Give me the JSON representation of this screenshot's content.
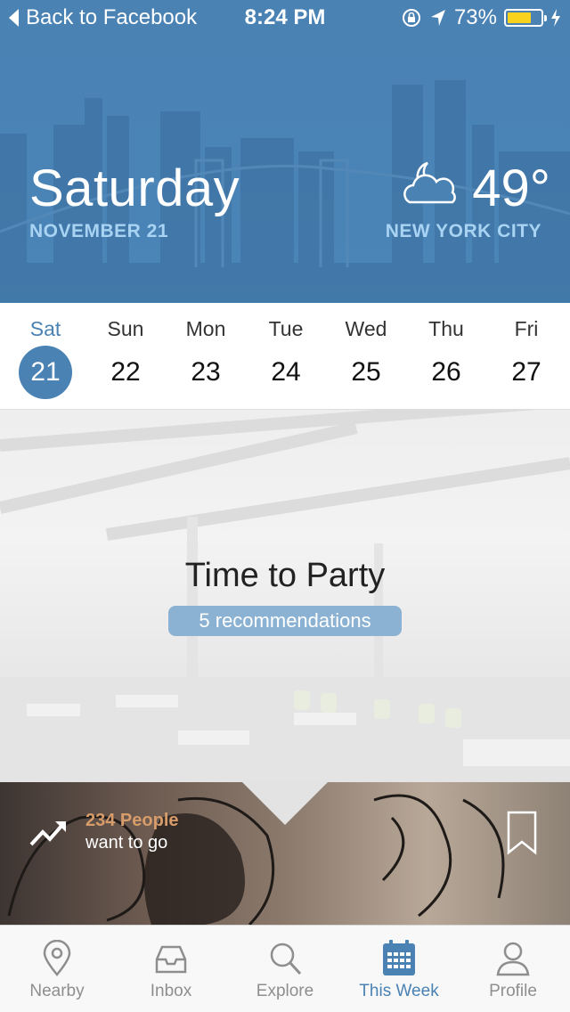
{
  "status_bar": {
    "back_label": "Back to Facebook",
    "time": "8:24 PM",
    "battery_percent": "73%",
    "battery_level": 0.73,
    "icons": [
      "orientation-lock-icon",
      "location-arrow-icon",
      "battery-icon",
      "charging-bolt-icon"
    ]
  },
  "header": {
    "day_name": "Saturday",
    "date": "NOVEMBER 21",
    "temperature": "49°",
    "weather_icon": "cloudy-night-icon",
    "city": "NEW YORK CITY"
  },
  "week": {
    "days": [
      {
        "abbr": "Sat",
        "num": "21",
        "active": true
      },
      {
        "abbr": "Sun",
        "num": "22",
        "active": false
      },
      {
        "abbr": "Mon",
        "num": "23",
        "active": false
      },
      {
        "abbr": "Tue",
        "num": "24",
        "active": false
      },
      {
        "abbr": "Wed",
        "num": "25",
        "active": false
      },
      {
        "abbr": "Thu",
        "num": "26",
        "active": false
      },
      {
        "abbr": "Fri",
        "num": "27",
        "active": false
      }
    ]
  },
  "feature": {
    "title": "Time to Party",
    "recommendations": "5 recommendations"
  },
  "next_card": {
    "people_count": "234 People",
    "people_sub": "want to go",
    "icons": [
      "trending-up-icon",
      "bookmark-icon"
    ]
  },
  "tabbar": {
    "tabs": [
      {
        "label": "Nearby",
        "icon": "location-pin-icon",
        "active": false
      },
      {
        "label": "Inbox",
        "icon": "inbox-tray-icon",
        "active": false
      },
      {
        "label": "Explore",
        "icon": "search-icon",
        "active": false
      },
      {
        "label": "This Week",
        "icon": "calendar-icon",
        "active": true
      },
      {
        "label": "Profile",
        "icon": "person-icon",
        "active": false
      }
    ]
  },
  "colors": {
    "accent": "#4a82b4",
    "date_text": "#a8d3f3",
    "pill": "#8bb2d2",
    "people_count": "#d79c6a",
    "battery": "#f8d21c"
  }
}
